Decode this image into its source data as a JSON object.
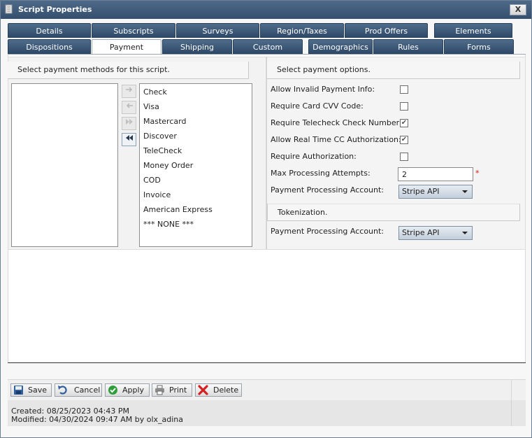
{
  "window": {
    "title": "Script Properties",
    "close_label": "X"
  },
  "tabs": {
    "row1": [
      "Details",
      "Subscripts",
      "Surveys",
      "Region/Taxes",
      "Prod Offers",
      "Elements"
    ],
    "row2": [
      "Dispositions",
      "Payment",
      "Shipping",
      "Custom",
      "Demographics",
      "Rules",
      "Forms"
    ],
    "active": "Payment"
  },
  "payment_methods": {
    "header": "Select payment methods for this script.",
    "selected": [],
    "available": [
      "Check",
      "Visa",
      "Mastercard",
      "Discover",
      "TeleCheck",
      "Money Order",
      "COD",
      "Invoice",
      "American Express",
      "*** NONE ***"
    ]
  },
  "payment_options": {
    "header": "Select payment options.",
    "allow_invalid": {
      "label": "Allow Invalid Payment Info:",
      "checked": false
    },
    "require_cvv": {
      "label": "Require Card CVV Code:",
      "checked": false
    },
    "require_telecheck": {
      "label": "Require Telecheck Check Number:",
      "checked": true
    },
    "allow_realtime_cc": {
      "label": "Allow Real Time CC Authorization:",
      "checked": true
    },
    "require_auth": {
      "label": "Require Authorization:",
      "checked": false
    },
    "max_attempts": {
      "label": "Max Processing Attempts:",
      "value": "2",
      "required_mark": "*"
    },
    "processing_account": {
      "label": "Payment Processing Account:",
      "value": "Stripe API"
    }
  },
  "tokenization": {
    "header": "Tokenization.",
    "processing_account": {
      "label": "Payment Processing Account:",
      "value": "Stripe API"
    }
  },
  "toolbar": {
    "save": "Save",
    "cancel": "Cancel",
    "apply": "Apply",
    "print": "Print",
    "delete": "Delete"
  },
  "footer": {
    "created": "Created: 08/25/2023 04:43 PM",
    "modified": "Modified: 04/30/2024 09:47 AM by olx_adina"
  },
  "check_mark": "✔"
}
